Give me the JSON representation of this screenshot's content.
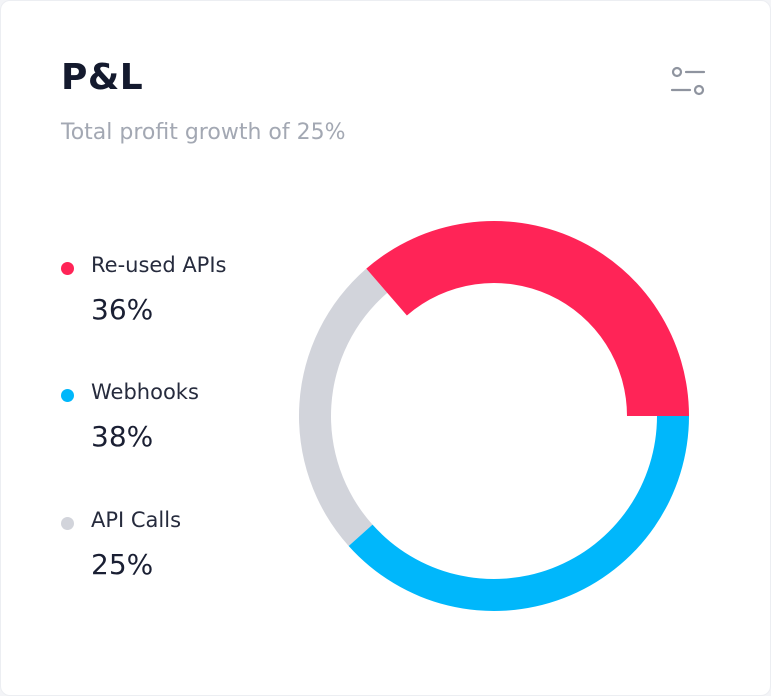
{
  "card": {
    "title": "P&L",
    "subtitle": "Total profit growth of 25%",
    "filter_icon": "sliders-icon"
  },
  "legend": [
    {
      "label": "Re-used APIs",
      "value": "36%",
      "color": "#ff2457"
    },
    {
      "label": "Webhooks",
      "value": "38%",
      "color": "#00b7fb"
    },
    {
      "label": "API Calls",
      "value": "25%",
      "color": "#d2d4db"
    }
  ],
  "chart_data": {
    "type": "donut",
    "series": [
      {
        "name": "Re-used APIs",
        "value": 36,
        "color": "#ff2457"
      },
      {
        "name": "Webhooks",
        "value": 38,
        "color": "#00b7fb"
      },
      {
        "name": "API Calls",
        "value": 25,
        "color": "#d2d4db"
      }
    ]
  }
}
